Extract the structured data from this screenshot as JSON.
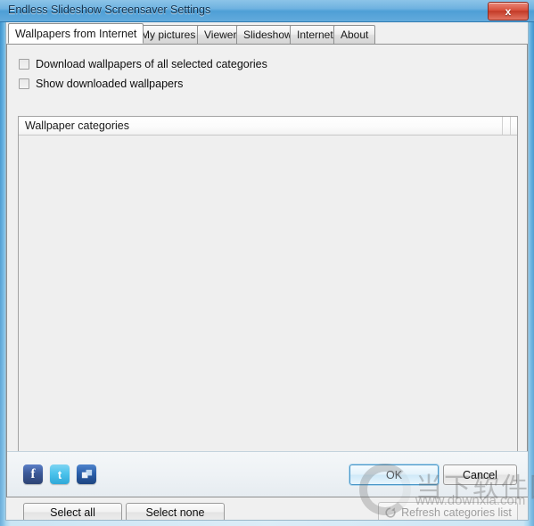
{
  "window": {
    "title": "Endless Slideshow Screensaver Settings",
    "close_label": "x",
    "close_icon": "close-icon"
  },
  "tabs": [
    {
      "label": "Wallpapers from Internet",
      "active": true
    },
    {
      "label": "My pictures",
      "active": false
    },
    {
      "label": "Viewer",
      "active": false
    },
    {
      "label": "Slideshow",
      "active": false
    },
    {
      "label": "Internet",
      "active": false
    },
    {
      "label": "About",
      "active": false
    }
  ],
  "options": [
    {
      "label": "Download wallpapers of all selected categories",
      "checked": false
    },
    {
      "label": "Show downloaded wallpapers",
      "checked": false
    }
  ],
  "list": {
    "column_header": "Wallpaper categories",
    "rows": []
  },
  "buttons": {
    "select_all": "Select all",
    "select_none": "Select none",
    "refresh": "Refresh categories list",
    "refresh_icon": "refresh-icon",
    "refresh_disabled": true,
    "ok": "OK",
    "cancel": "Cancel"
  },
  "social": [
    {
      "name": "facebook",
      "glyph": "f"
    },
    {
      "name": "twitter",
      "glyph": "t"
    },
    {
      "name": "share",
      "glyph": ""
    }
  ],
  "watermark": {
    "text_cn": "当下软件园",
    "url": "www.downxia.com"
  },
  "colors": {
    "titlebar_blue": "#4e9fd6",
    "frame_blue": "#3e93cc",
    "close_red": "#c33b28",
    "panel_gray": "#f0f0f0",
    "list_gray": "#efefef",
    "default_button_blue": "#4b97c8"
  }
}
